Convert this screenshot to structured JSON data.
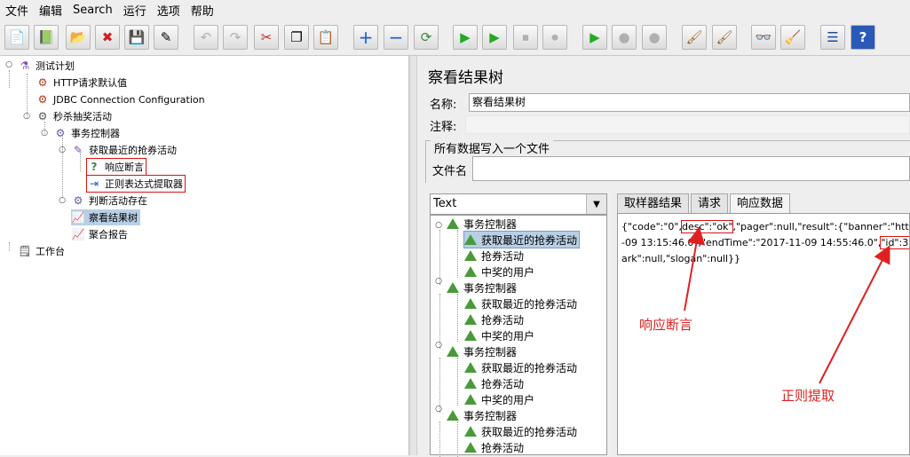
{
  "menu": [
    "文件",
    "编辑",
    "Search",
    "运行",
    "选项",
    "帮助"
  ],
  "toolbar": {
    "icons": [
      "new-icon",
      "templates-icon",
      "open-icon",
      "close-icon",
      "save-icon",
      "save-as-icon",
      "undo-icon",
      "redo-icon",
      "cut-icon",
      "copy-icon",
      "paste-icon",
      "expand-icon",
      "collapse-icon",
      "toggle-icon",
      "start-icon",
      "start-no-pause-icon",
      "stop-icon",
      "shutdown-icon",
      "remote-start-icon",
      "remote-stop-icon",
      "remote-shutdown-icon",
      "clear-icon",
      "clear-all-icon",
      "search-icon",
      "reset-search-icon",
      "function-helper-icon",
      "help-icon"
    ],
    "glyphs": [
      "📄",
      "📗",
      "📂",
      "✖",
      "💾",
      "✎",
      "↶",
      "↷",
      "✂",
      "❐",
      "📋",
      "+",
      "−",
      "⟳",
      "▶",
      "▶",
      "⏹",
      "⏺",
      "▶",
      "●",
      "●",
      "🖌",
      "🖌",
      "👓",
      "🧹",
      "☰",
      "?"
    ]
  },
  "tree": [
    {
      "label": "测试计划",
      "icon": "flask-icon"
    },
    {
      "label": "HTTP请求默认值",
      "icon": "http-defaults-icon"
    },
    {
      "label": "JDBC Connection Configuration",
      "icon": "jdbc-config-icon"
    },
    {
      "label": "秒杀抽奖活动",
      "icon": "thread-group-icon"
    },
    {
      "label": "事务控制器",
      "icon": "controller-icon"
    },
    {
      "label": "获取最近的抢券活动",
      "icon": "sampler-icon"
    },
    {
      "label": "响应断言",
      "icon": "assertion-icon"
    },
    {
      "label": "正则表达式提取器",
      "icon": "extractor-icon"
    },
    {
      "label": "判断活动存在",
      "icon": "controller-icon"
    },
    {
      "label": "察看结果树",
      "icon": "listener-icon"
    },
    {
      "label": "聚合报告",
      "icon": "listener-icon"
    },
    {
      "label": "工作台",
      "icon": "workbench-icon"
    }
  ],
  "panel": {
    "title": "察看结果树",
    "name_label": "名称:",
    "name_value": "察看结果树",
    "comment_label": "注释:",
    "group_title": "所有数据写入一个文件",
    "file_label": "文件名"
  },
  "renderer": {
    "selected": "Text"
  },
  "results": [
    "事务控制器",
    "获取最近的抢券活动",
    "抢券活动",
    "中奖的用户",
    "事务控制器",
    "获取最近的抢券活动",
    "抢券活动",
    "中奖的用户",
    "事务控制器",
    "获取最近的抢券活动",
    "抢券活动",
    "中奖的用户",
    "事务控制器",
    "获取最近的抢券活动",
    "抢券活动"
  ],
  "tabs": [
    "取样器结果",
    "请求",
    "响应数据"
  ],
  "response": {
    "line1_a": "{\"code\":\"0\",",
    "line1_b": "desc\":\"ok\"",
    "line1_c": ",\"pager\":null,\"result\":{\"banner\":\"http://i",
    "line2_a": "-09 13:15:46.0\",\"endTime\":\"2017-11-09 14:55:46.0\",",
    "line2_b": "\"id\":30,",
    "line3": "ark\":null,\"slogan\":null}}"
  },
  "annotations": {
    "assertion": "响应断言",
    "regex": "正则提取"
  },
  "colors": {
    "annotation": "#e02020",
    "selection": "#b8cfe5",
    "result-icon": "#4a9a3a"
  }
}
